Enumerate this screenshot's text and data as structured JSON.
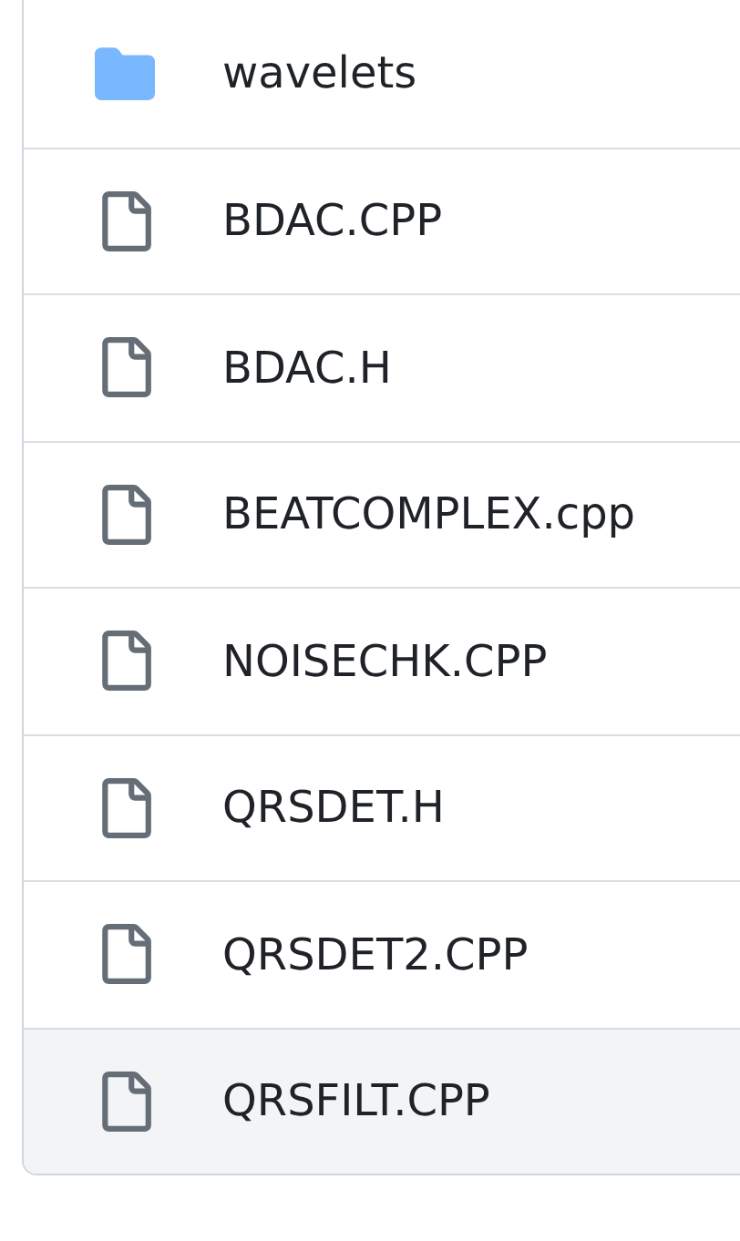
{
  "files": [
    {
      "kind": "folder",
      "name": "wavelets",
      "highlighted": false
    },
    {
      "kind": "file",
      "name": "BDAC.CPP",
      "highlighted": false
    },
    {
      "kind": "file",
      "name": "BDAC.H",
      "highlighted": false
    },
    {
      "kind": "file",
      "name": "BEATCOMPLEX.cpp",
      "highlighted": false
    },
    {
      "kind": "file",
      "name": "NOISECHK.CPP",
      "highlighted": false
    },
    {
      "kind": "file",
      "name": "QRSDET.H",
      "highlighted": false
    },
    {
      "kind": "file",
      "name": "QRSDET2.CPP",
      "highlighted": false
    },
    {
      "kind": "file",
      "name": "QRSFILT.CPP",
      "highlighted": true
    }
  ]
}
